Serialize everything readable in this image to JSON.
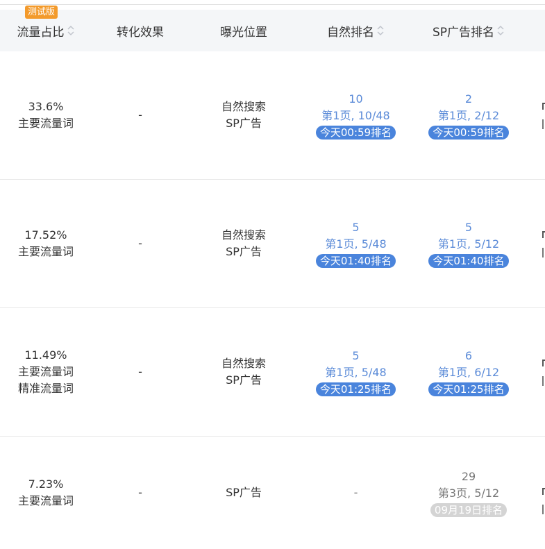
{
  "badge": "测试版",
  "headers": {
    "share": "流量占比",
    "conversion": "转化效果",
    "exposure": "曝光位置",
    "organic": "自然排名",
    "sp": "SP广告排名"
  },
  "rows": [
    {
      "share": "33.6%",
      "types": [
        "主要流量词"
      ],
      "conversion": "-",
      "exposure": [
        "自然搜索",
        "SP广告"
      ],
      "organic": {
        "rank": "10",
        "page": "第1页, 10/48",
        "time": "今天00:59排名"
      },
      "sp": {
        "rank": "2",
        "page": "第1页, 2/12",
        "time": "今天00:59排名"
      }
    },
    {
      "share": "17.52%",
      "types": [
        "主要流量词"
      ],
      "conversion": "-",
      "exposure": [
        "自然搜索",
        "SP广告"
      ],
      "organic": {
        "rank": "5",
        "page": "第1页, 5/48",
        "time": "今天01:40排名"
      },
      "sp": {
        "rank": "5",
        "page": "第1页, 5/12",
        "time": "今天01:40排名"
      }
    },
    {
      "share": "11.49%",
      "types": [
        "主要流量词",
        "精准流量词"
      ],
      "conversion": "-",
      "exposure": [
        "自然搜索",
        "SP广告"
      ],
      "organic": {
        "rank": "5",
        "page": "第1页, 5/48",
        "time": "今天01:25排名"
      },
      "sp": {
        "rank": "6",
        "page": "第1页, 6/12",
        "time": "今天01:25排名"
      }
    },
    {
      "share": "7.23%",
      "types": [
        "主要流量词"
      ],
      "conversion": "-",
      "exposure": [
        "SP广告"
      ],
      "organic": {
        "empty": "-"
      },
      "sp": {
        "rank": "29",
        "page": "第3页, 5/12",
        "time": "09月19日排名"
      }
    }
  ]
}
